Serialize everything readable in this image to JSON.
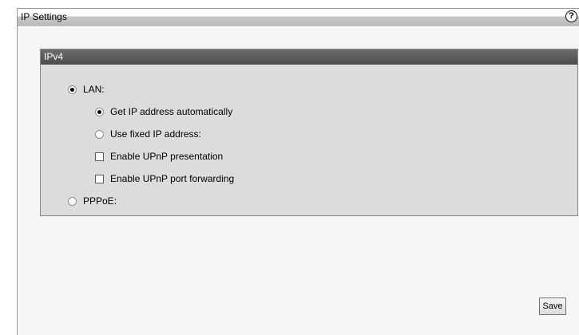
{
  "window": {
    "title": "IP Settings",
    "help_icon": "?",
    "icon": "help-circle-icon"
  },
  "ipv4": {
    "header": "IPv4",
    "options": {
      "lan": {
        "label": "LAN:",
        "selected": true
      },
      "get_ip_auto": {
        "label": "Get IP address automatically",
        "selected": true
      },
      "use_fixed_ip": {
        "label": "Use fixed IP address:",
        "selected": false
      },
      "upnp_presentation": {
        "label": "Enable UPnP presentation",
        "checked": false
      },
      "upnp_port_forwarding": {
        "label": "Enable UPnP port forwarding",
        "checked": false
      },
      "pppoe": {
        "label": "PPPoE:",
        "selected": false
      }
    }
  },
  "footer": {
    "save_label": "Save"
  }
}
